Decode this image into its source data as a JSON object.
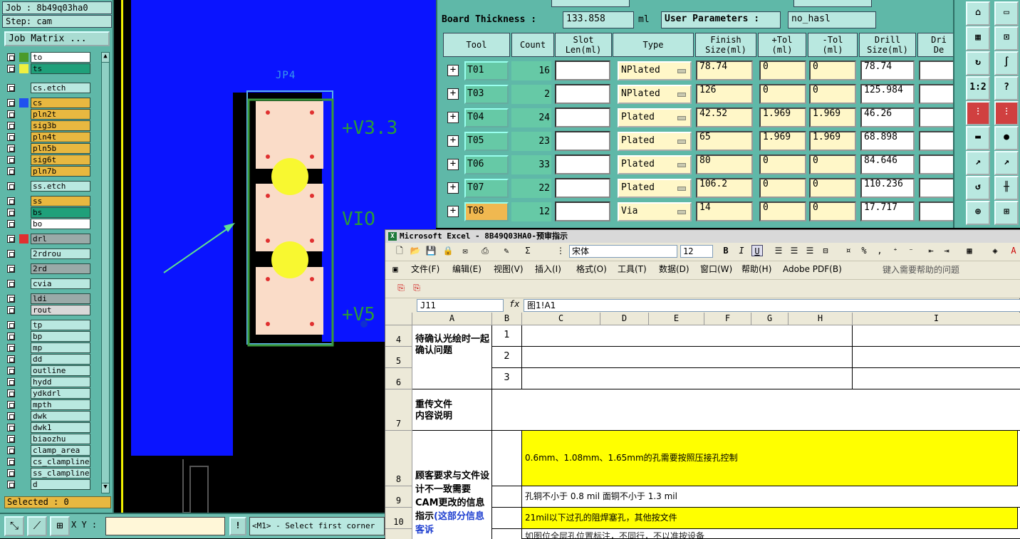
{
  "left_panel": {
    "job": "Job : 8b49q03ha0",
    "step": "Step: cam",
    "job_matrix_button": "Job Matrix ...",
    "layers": [
      {
        "name": "to",
        "color": "#ffffff",
        "swatch": "#4a9a2a"
      },
      {
        "name": "ts",
        "color": "#1fa07a",
        "swatch": "#f0f040"
      },
      {
        "name": "cs.etch",
        "color": "#b9e8e0",
        "swatch": ""
      },
      {
        "name": "cs",
        "color": "#e8b840",
        "swatch": "#2050f0"
      },
      {
        "name": "pln2t",
        "color": "#e8b840",
        "swatch": ""
      },
      {
        "name": "sig3b",
        "color": "#e8b840",
        "swatch": ""
      },
      {
        "name": "pln4t",
        "color": "#e8b840",
        "swatch": ""
      },
      {
        "name": "pln5b",
        "color": "#e8b840",
        "swatch": ""
      },
      {
        "name": "sig6t",
        "color": "#e8b840",
        "swatch": ""
      },
      {
        "name": "pln7b",
        "color": "#e8b840",
        "swatch": ""
      },
      {
        "name": "ss.etch",
        "color": "#b9e8e0",
        "swatch": ""
      },
      {
        "name": "ss",
        "color": "#e8b840",
        "swatch": ""
      },
      {
        "name": "bs",
        "color": "#1fa07a",
        "swatch": ""
      },
      {
        "name": "bo",
        "color": "#ffffff",
        "swatch": ""
      },
      {
        "name": "drl",
        "color": "#9aaaa8",
        "swatch": "#e03030"
      },
      {
        "name": "2rdrou",
        "color": "#b9e8e0",
        "swatch": ""
      },
      {
        "name": "2rd",
        "color": "#9aaaa8",
        "swatch": ""
      },
      {
        "name": "cvia",
        "color": "#b9e8e0",
        "swatch": ""
      },
      {
        "name": "ldi",
        "color": "#9aaaa8",
        "swatch": ""
      },
      {
        "name": "rout",
        "color": "#d8d8d8",
        "swatch": ""
      },
      {
        "name": "tp",
        "color": "#b9e8e0",
        "swatch": ""
      },
      {
        "name": "bp",
        "color": "#b9e8e0",
        "swatch": ""
      },
      {
        "name": "mp",
        "color": "#b9e8e0",
        "swatch": ""
      },
      {
        "name": "dd",
        "color": "#b9e8e0",
        "swatch": ""
      },
      {
        "name": "outline",
        "color": "#b9e8e0",
        "swatch": ""
      },
      {
        "name": "hydd",
        "color": "#b9e8e0",
        "swatch": ""
      },
      {
        "name": "ydkdrl",
        "color": "#b9e8e0",
        "swatch": ""
      },
      {
        "name": "mpth",
        "color": "#b9e8e0",
        "swatch": ""
      },
      {
        "name": "dwk",
        "color": "#b9e8e0",
        "swatch": ""
      },
      {
        "name": "dwk1",
        "color": "#b9e8e0",
        "swatch": ""
      },
      {
        "name": "biaozhu",
        "color": "#b9e8e0",
        "swatch": ""
      },
      {
        "name": "clamp_area",
        "color": "#b9e8e0",
        "swatch": ""
      },
      {
        "name": "cs_clampline",
        "color": "#b9e8e0",
        "swatch": ""
      },
      {
        "name": "ss_clampline",
        "color": "#b9e8e0",
        "swatch": ""
      },
      {
        "name": "d",
        "color": "#b9e8e0",
        "swatch": ""
      }
    ],
    "selected": "Selected : 0"
  },
  "canvas": {
    "component_label": "JP4",
    "net_labels": [
      "+V3.3",
      "VIO",
      "+V5"
    ]
  },
  "bottom_bar": {
    "xy_label": "X Y :",
    "xy_value": "",
    "excl": "!",
    "message": "<M1> - Select first corner"
  },
  "drill_panel": {
    "board_thickness_label": "Board Thickness :",
    "board_thickness_value": "133.858",
    "board_thickness_unit": "ml",
    "user_params_label": "User Parameters :",
    "user_params_value": "no_hasl",
    "columns": [
      "Tool",
      "Count",
      "Slot\nLen(ml)",
      "Type",
      "Finish\nSize(ml)",
      "+Tol\n(ml)",
      "-Tol\n(ml)",
      "Drill\nSize(ml)",
      "Dri\nDe"
    ],
    "rows": [
      {
        "tool": "T01",
        "count": "16",
        "slot": "",
        "type": "NPlated",
        "finish": "78.74",
        "ptol": "0",
        "ntol": "0",
        "drill": "78.74"
      },
      {
        "tool": "T03",
        "count": "2",
        "slot": "",
        "type": "NPlated",
        "finish": "126",
        "ptol": "0",
        "ntol": "0",
        "drill": "125.984"
      },
      {
        "tool": "T04",
        "count": "24",
        "slot": "",
        "type": "Plated",
        "finish": "42.52",
        "ptol": "1.969",
        "ntol": "1.969",
        "drill": "46.26"
      },
      {
        "tool": "T05",
        "count": "23",
        "slot": "",
        "type": "Plated",
        "finish": "65",
        "ptol": "1.969",
        "ntol": "1.969",
        "drill": "68.898"
      },
      {
        "tool": "T06",
        "count": "33",
        "slot": "",
        "type": "Plated",
        "finish": "80",
        "ptol": "0",
        "ntol": "0",
        "drill": "84.646"
      },
      {
        "tool": "T07",
        "count": "22",
        "slot": "",
        "type": "Plated",
        "finish": "106.2",
        "ptol": "0",
        "ntol": "0",
        "drill": "110.236"
      },
      {
        "tool": "T08",
        "count": "12",
        "slot": "",
        "type": "Via",
        "finish": "14",
        "ptol": "0",
        "ntol": "0",
        "drill": "17.717"
      }
    ]
  },
  "right_toolbar": {
    "buttons": [
      "home-icon",
      "window-icon",
      "grid-icon",
      "step-icon",
      "loop-icon",
      "curve-icon",
      "scale-icon",
      "help-icon",
      "drill-red-icon",
      "drill-red-icon-2",
      "ruler-icon",
      "dot-icon",
      "pin-icon",
      "pin-icon-2",
      "undo-icon",
      "flag-icon",
      "move-icon",
      "snap-icon"
    ],
    "scale_text": "1:2",
    "help_text": "?"
  },
  "excel": {
    "title": "Microsoft Excel - 8B49Q03HA0-预审指示",
    "font_name": "宋体",
    "font_size": "12",
    "menus": [
      "文件(F)",
      "编辑(E)",
      "视图(V)",
      "插入(I)",
      "格式(O)",
      "工具(T)",
      "数据(D)",
      "窗口(W)",
      "帮助(H)",
      "Adobe PDF(B)"
    ],
    "help_placeholder": "键入需要帮助的问题",
    "name_box": "J11",
    "fx": "fx",
    "formula": "图1!A1",
    "col_headers": [
      "A",
      "B",
      "C",
      "D",
      "E",
      "F",
      "G",
      "H",
      "I"
    ],
    "row_headers": [
      "4",
      "5",
      "6",
      "7",
      "8",
      "9",
      "10"
    ],
    "a4": "待确认光绘时一起确认问题",
    "b4": "1",
    "b5": "2",
    "b6": "3",
    "a7": "重传文件\n内容说明",
    "a8": "顾客要求与文件设计不一致需要CAM更改的信息指示",
    "a8_blue": "(这部分信息客诉",
    "c8": "0.6mm、1.08mm、1.65mm的孔需要按照压接孔控制",
    "c9": "孔铜不小于 0.8 mil  面铜不小于 1.3 mil",
    "c10": "21mil以下过孔的阻焊塞孔，其他按文件",
    "c11": "如图位全层孔位置标注，不同行，不以准按设备",
    "highlight": "#ffff00",
    "blue_text": "#2040d0"
  }
}
